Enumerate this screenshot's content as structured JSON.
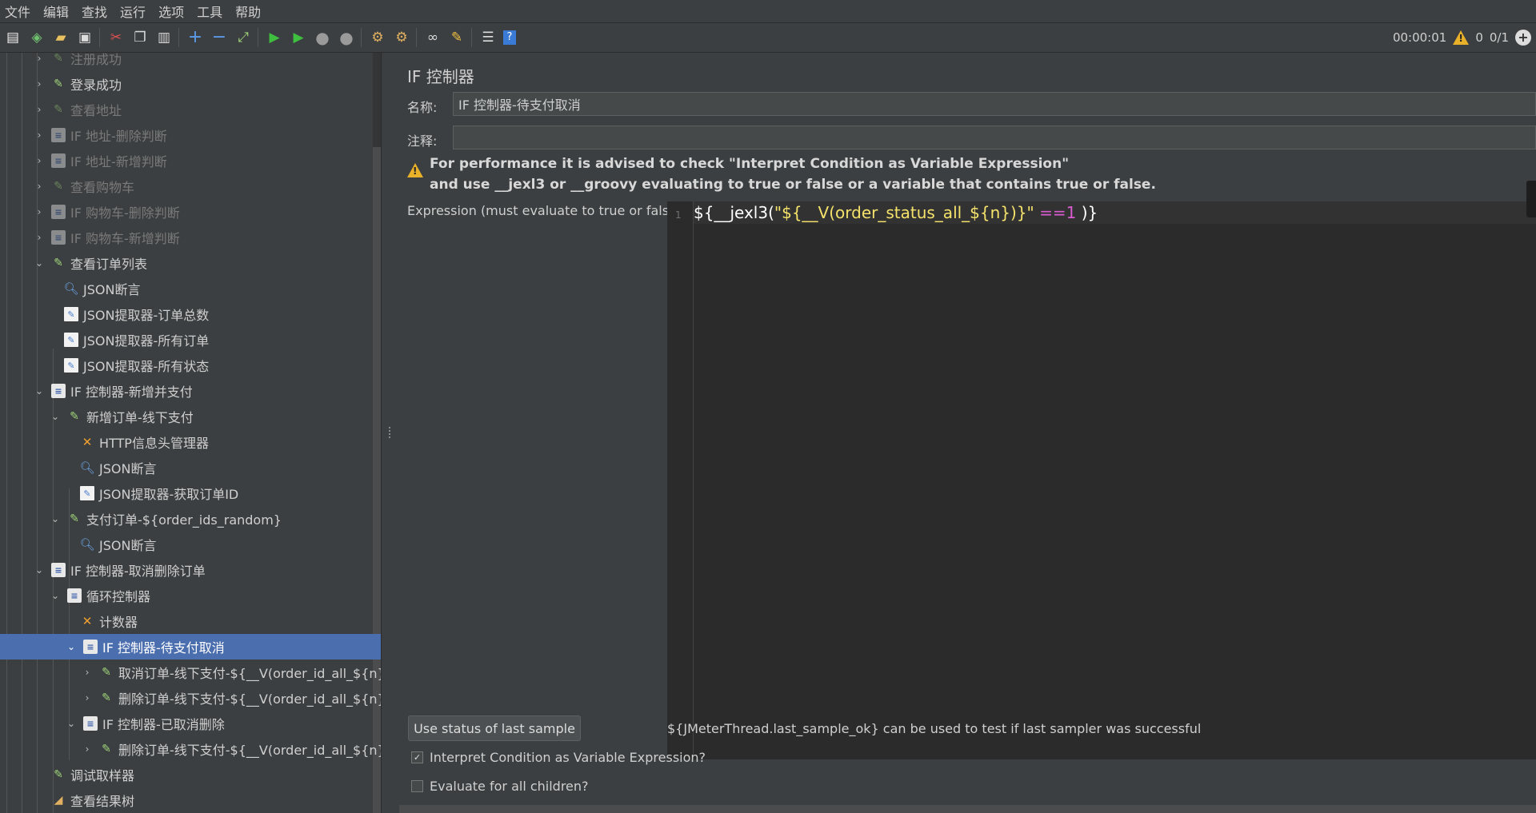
{
  "menu": [
    "文件",
    "编辑",
    "查找",
    "运行",
    "选项",
    "工具",
    "帮助"
  ],
  "toolbar": {
    "timer": "00:00:01",
    "warnings": "0",
    "threads": "0/1",
    "icons": [
      "new-icon",
      "templates-icon",
      "open-icon",
      "save-icon",
      "cut-icon",
      "copy-icon",
      "paste-icon",
      "expand-icon",
      "collapse-icon",
      "toggle-icon",
      "start-icon",
      "start-no-pause-icon",
      "stop-icon",
      "shutdown-icon",
      "clear-icon",
      "clear-all-icon",
      "search-icon",
      "reset-search-icon",
      "function-helper-icon",
      "help-icon"
    ]
  },
  "tree": {
    "items": [
      {
        "label": "注册成功",
        "dim": true
      },
      {
        "label": "登录成功",
        "dim": false
      },
      {
        "label": "查看地址",
        "dim": true
      },
      {
        "label": "IF 地址-删除判断",
        "dim": true
      },
      {
        "label": "IF 地址-新增判断",
        "dim": true
      },
      {
        "label": "查看购物车",
        "dim": true
      },
      {
        "label": "IF 购物车-删除判断",
        "dim": true
      },
      {
        "label": "IF 购物车-新增判断",
        "dim": true
      },
      {
        "label": "查看订单列表",
        "dim": false
      },
      {
        "label": "JSON断言",
        "dim": false
      },
      {
        "label": "JSON提取器-订单总数",
        "dim": false
      },
      {
        "label": "JSON提取器-所有订单",
        "dim": false
      },
      {
        "label": "JSON提取器-所有状态",
        "dim": false
      },
      {
        "label": "IF 控制器-新增并支付",
        "dim": false
      },
      {
        "label": "新增订单-线下支付",
        "dim": false
      },
      {
        "label": "HTTP信息头管理器",
        "dim": false
      },
      {
        "label": "JSON断言",
        "dim": false
      },
      {
        "label": "JSON提取器-获取订单ID",
        "dim": false
      },
      {
        "label": "支付订单-${order_ids_random}",
        "dim": false
      },
      {
        "label": "JSON断言",
        "dim": false
      },
      {
        "label": "IF 控制器-取消删除订单",
        "dim": false
      },
      {
        "label": "循环控制器",
        "dim": false
      },
      {
        "label": "计数器",
        "dim": false
      },
      {
        "label": "IF 控制器-待支付取消",
        "dim": false
      },
      {
        "label": "取消订单-线下支付-${__V(order_id_all_${n})}",
        "dim": false
      },
      {
        "label": "删除订单-线下支付-${__V(order_id_all_${n})}",
        "dim": false
      },
      {
        "label": "IF 控制器-已取消删除",
        "dim": false
      },
      {
        "label": "删除订单-线下支付-${__V(order_id_all_${n})}",
        "dim": false
      },
      {
        "label": "调试取样器",
        "dim": false
      },
      {
        "label": "查看结果树",
        "dim": false
      }
    ]
  },
  "panel": {
    "title": "IF 控制器",
    "name_label": "名称:",
    "name_value": "IF 控制器-待支付取消",
    "comment_label": "注释:",
    "comment_value": "",
    "warning_line1": "For performance it is advised to check \"Interpret Condition as Variable Expression\"",
    "warning_line2": "and use __jexl3 or __groovy evaluating to true or false or a variable that contains true or false.",
    "expression_label": "Expression (must evaluate to true or false)",
    "line_number": "1",
    "code": {
      "p1": "${__jexl3(",
      "p2": "\"${__V(order_status_all_${n})}\"",
      "p3": " ",
      "p4": "==",
      "p5": "1",
      "p6": " )}"
    },
    "last_sample_button": "Use status of last sample",
    "hint": "${JMeterThread.last_sample_ok} can be used to test if last sampler was successful",
    "interpret_label": "Interpret Condition as Variable Expression?",
    "interpret_checked": true,
    "evaluate_all_label": "Evaluate for all children?",
    "evaluate_all_checked": false
  }
}
